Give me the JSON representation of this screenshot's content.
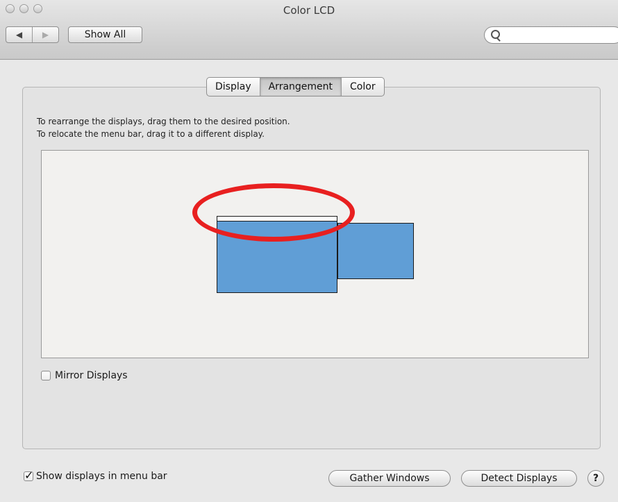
{
  "window": {
    "title": "Color LCD"
  },
  "toolbar": {
    "back_icon": "◀",
    "forward_icon": "▶",
    "show_all_label": "Show All",
    "search": {
      "value": "",
      "placeholder": ""
    }
  },
  "tabs": [
    {
      "label": "Display",
      "active": false
    },
    {
      "label": "Arrangement",
      "active": true
    },
    {
      "label": "Color",
      "active": false
    }
  ],
  "instructions": [
    "To rearrange the displays, drag them to the desired position.",
    "To relocate the menu bar, drag it to a different display."
  ],
  "arrangement": {
    "display_color": "#609ed6",
    "highlight_color": "#e82020"
  },
  "mirror_displays": {
    "label": "Mirror Displays",
    "checked": false
  },
  "bottom": {
    "show_in_menu_bar": {
      "label": "Show displays in menu bar",
      "checked": true
    },
    "gather_windows_label": "Gather Windows",
    "detect_displays_label": "Detect Displays",
    "help_label": "?"
  }
}
